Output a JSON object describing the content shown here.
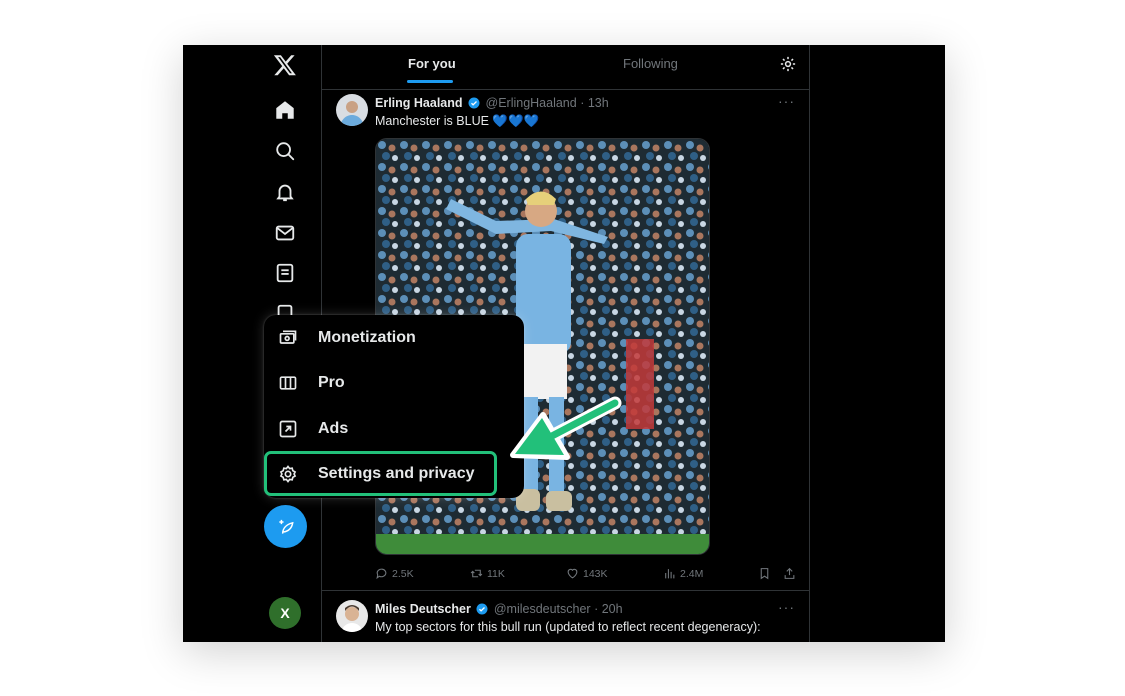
{
  "tabs": [
    {
      "label": "For you",
      "active": true
    },
    {
      "label": "Following",
      "active": false
    }
  ],
  "posts": [
    {
      "name": "Erling Haaland",
      "handle": "@ErlingHaaland",
      "time": "· 13h",
      "text": "Manchester is BLUE 💙💙💙",
      "stats": {
        "replies": "2.5K",
        "reposts": "11K",
        "likes": "143K",
        "views": "2.4M"
      }
    },
    {
      "name": "Miles Deutscher",
      "handle": "@milesdeutscher",
      "time": "· 20h",
      "text": "My top sectors for this bull run (updated to reflect recent degeneracy):"
    }
  ],
  "menu": {
    "items": [
      {
        "label": "Monetization",
        "icon": "money-icon"
      },
      {
        "label": "Pro",
        "icon": "columns-icon"
      },
      {
        "label": "Ads",
        "icon": "external-box-icon"
      },
      {
        "label": "Settings and privacy",
        "icon": "gear-icon"
      }
    ]
  },
  "user": {
    "avatar_letter": "X"
  },
  "colors": {
    "accent": "#1d9bf0",
    "highlight": "#22c07a",
    "background": "#000000",
    "text": "#e7e9ea",
    "muted": "#71767b"
  }
}
